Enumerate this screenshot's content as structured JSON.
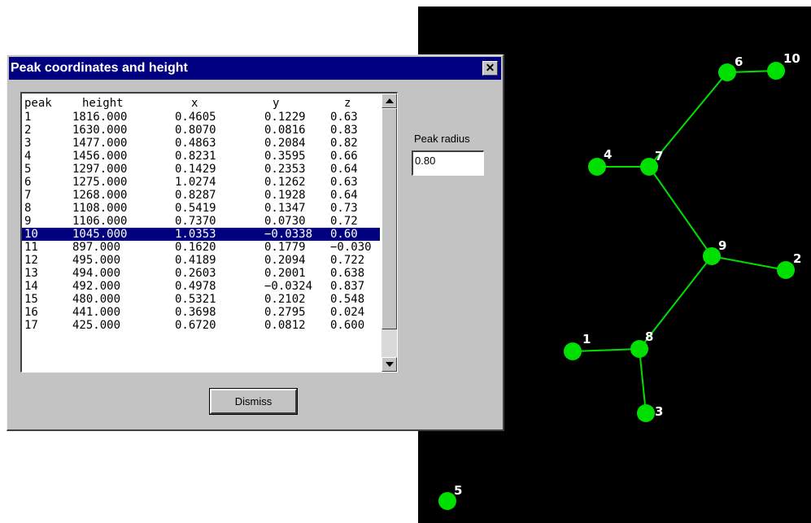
{
  "dialog": {
    "title": "Peak coordinates and height",
    "close_label": "✕",
    "table": {
      "headers": {
        "peak": "peak",
        "height": "height",
        "x": "x",
        "y": "y",
        "z": "z"
      },
      "rows": [
        {
          "peak": "1",
          "height": "1816.000",
          "x": "0.4605",
          "y": "0.1229",
          "z": "0.63"
        },
        {
          "peak": "2",
          "height": "1630.000",
          "x": "0.8070",
          "y": "0.0816",
          "z": "0.83"
        },
        {
          "peak": "3",
          "height": "1477.000",
          "x": "0.4863",
          "y": "0.2084",
          "z": "0.82"
        },
        {
          "peak": "4",
          "height": "1456.000",
          "x": "0.8231",
          "y": "0.3595",
          "z": "0.66"
        },
        {
          "peak": "5",
          "height": "1297.000",
          "x": "0.1429",
          "y": "0.2353",
          "z": "0.64"
        },
        {
          "peak": "6",
          "height": "1275.000",
          "x": "1.0274",
          "y": "0.1262",
          "z": "0.63"
        },
        {
          "peak": "7",
          "height": "1268.000",
          "x": "0.8287",
          "y": "0.1928",
          "z": "0.64"
        },
        {
          "peak": "8",
          "height": "1108.000",
          "x": "0.5419",
          "y": "0.1347",
          "z": "0.73"
        },
        {
          "peak": "9",
          "height": "1106.000",
          "x": "0.7370",
          "y": "0.0730",
          "z": "0.72"
        },
        {
          "peak": "10",
          "height": "1045.000",
          "x": "1.0353",
          "y": "−0.0338",
          "z": "0.60"
        },
        {
          "peak": "11",
          "height": "897.000",
          "x": "0.1620",
          "y": "0.1779",
          "z": "−0.030"
        },
        {
          "peak": "12",
          "height": "495.000",
          "x": "0.4189",
          "y": "0.2094",
          "z": "0.722"
        },
        {
          "peak": "13",
          "height": "494.000",
          "x": "0.2603",
          "y": "0.2001",
          "z": "0.638"
        },
        {
          "peak": "14",
          "height": "492.000",
          "x": "0.4978",
          "y": "−0.0324",
          "z": "0.837"
        },
        {
          "peak": "15",
          "height": "480.000",
          "x": "0.5321",
          "y": "0.2102",
          "z": "0.548"
        },
        {
          "peak": "16",
          "height": "441.000",
          "x": "0.3698",
          "y": "0.2795",
          "z": "0.024"
        },
        {
          "peak": "17",
          "height": "425.000",
          "x": "0.6720",
          "y": "0.0812",
          "z": "0.600"
        }
      ],
      "selected_peak": "10"
    },
    "peak_radius_label": "Peak radius",
    "peak_radius_value": "0.80",
    "dismiss_label": "Dismiss"
  },
  "viewer": {
    "background": "#000000",
    "node_color": "#00e000",
    "edge_color": "#00e000",
    "label_color": "#ffffff",
    "nodes": [
      {
        "label": "1"
      },
      {
        "label": "2"
      },
      {
        "label": "3"
      },
      {
        "label": "4"
      },
      {
        "label": "5"
      },
      {
        "label": "6"
      },
      {
        "label": "7"
      },
      {
        "label": "8"
      },
      {
        "label": "9"
      },
      {
        "label": "10"
      }
    ],
    "edges": [
      [
        "6",
        "10"
      ],
      [
        "6",
        "7"
      ],
      [
        "4",
        "7"
      ],
      [
        "7",
        "9"
      ],
      [
        "9",
        "2"
      ],
      [
        "9",
        "8"
      ],
      [
        "1",
        "8"
      ],
      [
        "8",
        "3"
      ]
    ]
  }
}
